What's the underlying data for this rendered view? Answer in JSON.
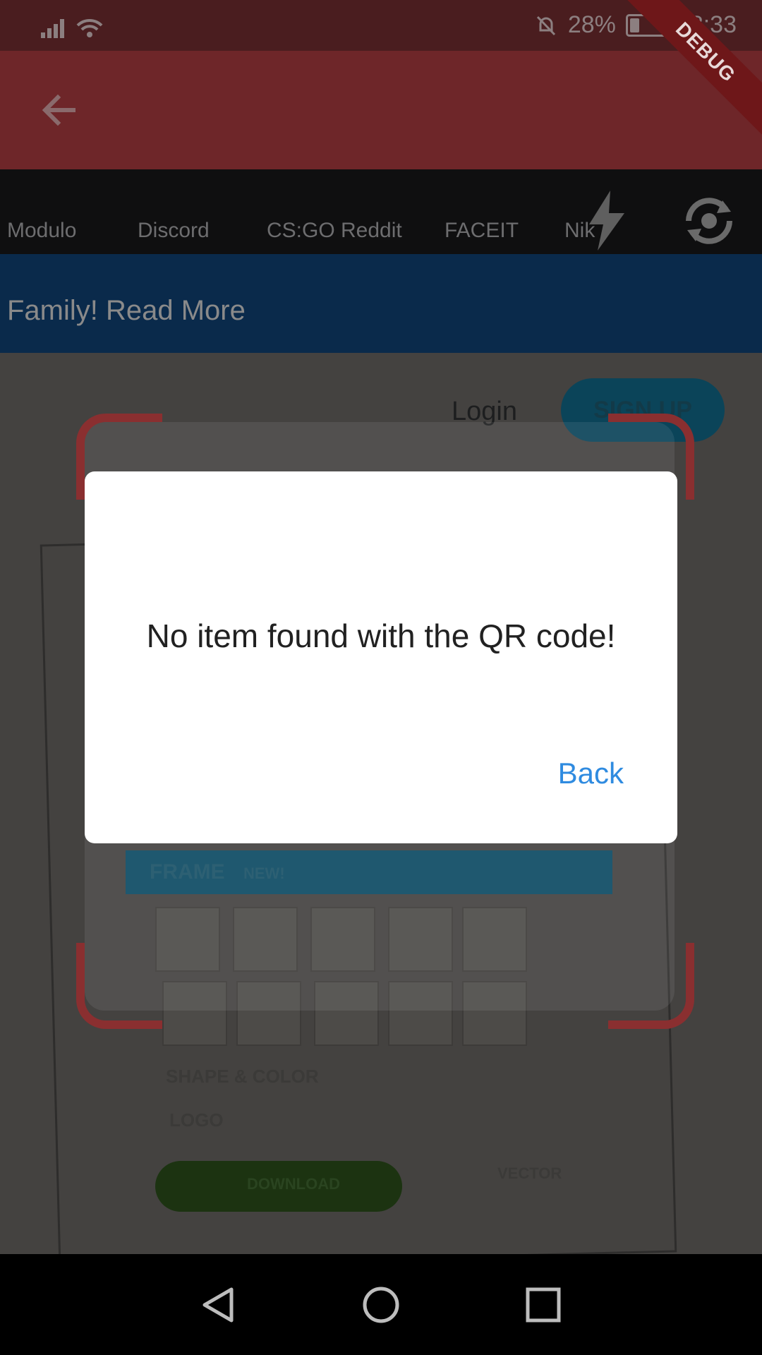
{
  "status_bar": {
    "battery": "28%",
    "battery_level": 0.28,
    "time": "18:33",
    "icons": [
      "signal-icon",
      "wifi-icon",
      "mute-bell-icon",
      "battery-icon"
    ]
  },
  "app_bar": {
    "back_icon": "arrow-back-icon",
    "debug_label": "DEBUG"
  },
  "camera_preview": {
    "tabs": [
      "Modulo",
      "Discord",
      "CS:GO Reddit",
      "FACEIT",
      "Nik"
    ],
    "banner": "Family! Read More",
    "login": "Login",
    "signup": "SIGN UP",
    "frame_label": "FRAME",
    "frame_badge": "NEW!",
    "shape_color": "SHAPE & COLOR",
    "logo": "LOGO",
    "download": "DOWNLOAD",
    "vector": "VECTOR",
    "flash_icon": "flash-icon",
    "switch_camera_icon": "switch-camera-icon"
  },
  "dialog": {
    "message": "No item found with the QR code!",
    "back_label": "Back"
  },
  "colors": {
    "app_bar": "#6e2629",
    "dialog_bg": "#ffffff",
    "accent": "#2f8be0"
  },
  "nav_bar": {
    "items": [
      "back-triangle-icon",
      "home-circle-icon",
      "recents-square-icon"
    ]
  }
}
